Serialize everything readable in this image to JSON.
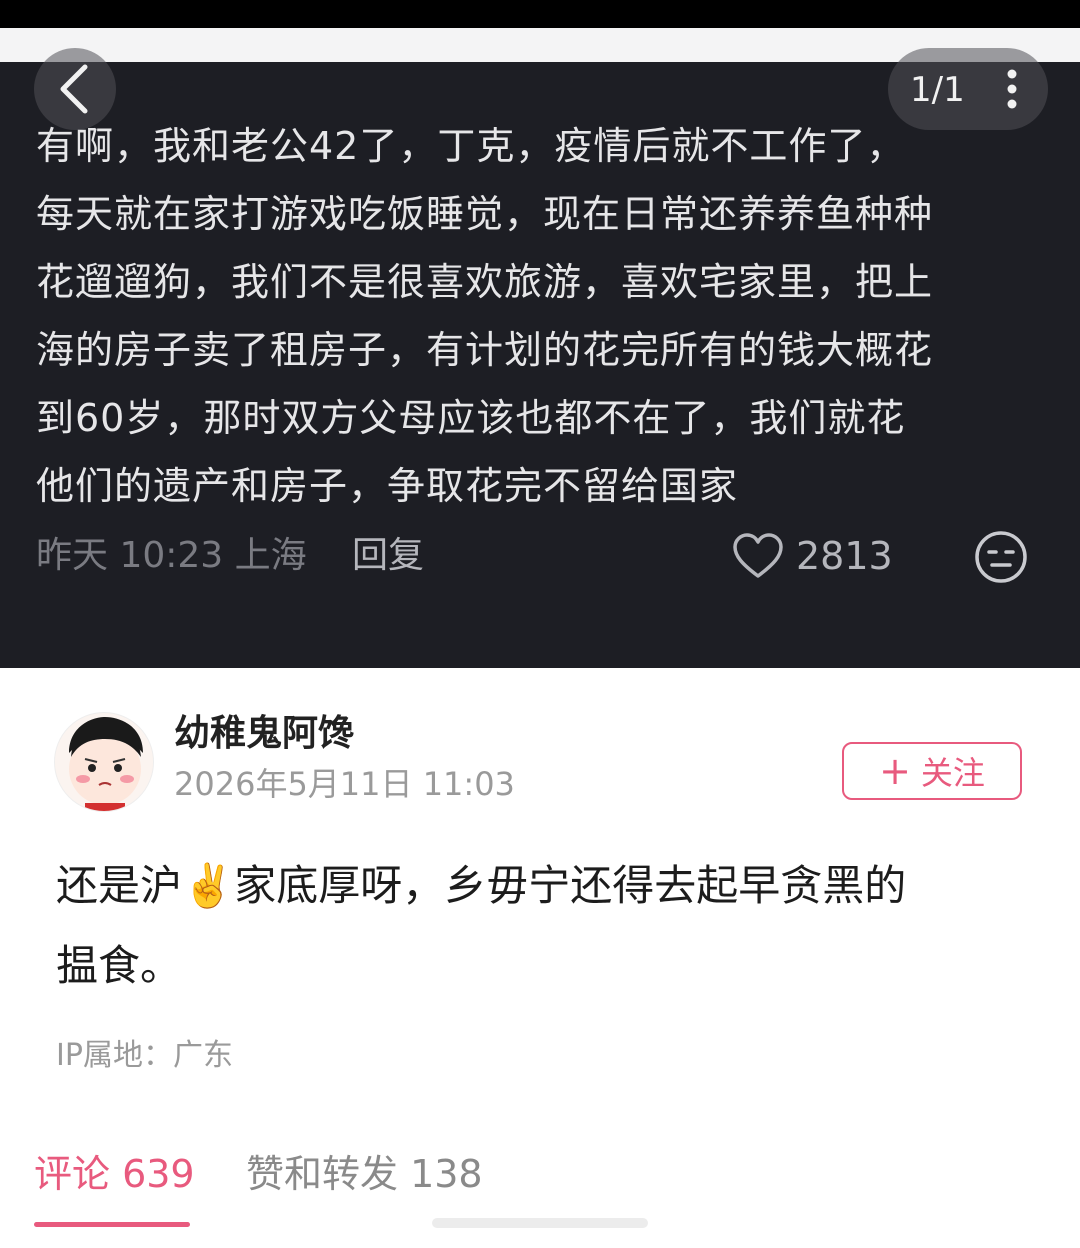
{
  "header": {
    "page_counter": "1/1"
  },
  "quoted_comment": {
    "lines": [
      "有啊，我和老公42了，丁克，疫情后就不工作了，",
      "每天就在家打游戏吃饭睡觉，现在日常还养养鱼种种",
      "花遛遛狗，我们不是很喜欢旅游，喜欢宅家里，把上",
      "海的房子卖了租房子，有计划的花完所有的钱大概花",
      "到60岁，那时双方父母应该也都不在了，我们就花",
      "他们的遗产和房子，争取花完不留给国家"
    ],
    "time_location": "昨天 10:23 上海",
    "reply_label": "回复",
    "like_count": "2813",
    "icons": {
      "back": "chevron-left-icon",
      "more": "more-vertical-icon",
      "like": "heart-icon",
      "emoji": "emoji-face-icon"
    }
  },
  "post": {
    "username": "幼稚鬼阿馋",
    "date": "2026年5月11日 11:03",
    "follow_plus": "+",
    "follow_label": "关注",
    "body_line1": "还是沪✌️家底厚呀，乡毋宁还得去起早贪黑的",
    "body_line2": "揾食。",
    "ip_location": "IP属地：广东"
  },
  "tabs": {
    "comments": "评论 639",
    "likes_shares": "赞和转发 138"
  },
  "colors": {
    "accent": "#e85a7e",
    "dark_bg": "#1d1e24"
  }
}
